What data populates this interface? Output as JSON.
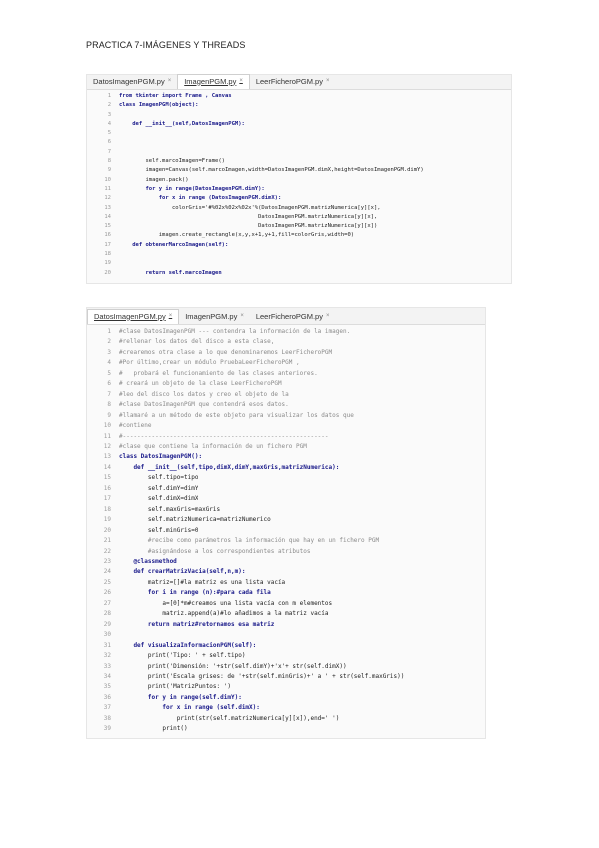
{
  "page_title": "PRACTICA 7-IMÁGENES Y THREADS",
  "editor1": {
    "tabs": [
      {
        "label": "DatosImagenPGM.py",
        "active": false
      },
      {
        "label": "ImagenPGM.py",
        "active": true
      },
      {
        "label": "LeerFicheroPGM.py",
        "active": false
      }
    ],
    "lines": [
      {
        "n": "1",
        "t": "from tkinter import Frame , Canvas"
      },
      {
        "n": "2",
        "t": "class ImagenPGM(object):"
      },
      {
        "n": "3",
        "t": ""
      },
      {
        "n": "4",
        "t": "    def __init__(self,DatosImagenPGM):"
      },
      {
        "n": "5",
        "t": ""
      },
      {
        "n": "6",
        "t": ""
      },
      {
        "n": "7",
        "t": ""
      },
      {
        "n": "8",
        "t": "        self.marcoImagen=Frame()"
      },
      {
        "n": "9",
        "t": "        imagen=Canvas(self.marcoImagen,width=DatosImagenPGM.dimX,height=DatosImagenPGM.dimY)"
      },
      {
        "n": "10",
        "t": "        imagen.pack()"
      },
      {
        "n": "11",
        "t": "        for y in range(DatosImagenPGM.dimY):"
      },
      {
        "n": "12",
        "t": "            for x in range (DatosImagenPGM.dimX):"
      },
      {
        "n": "13",
        "t": "                colorGris='#%02x%02x%02x'%(DatosImagenPGM.matrizNumerica[y][x],"
      },
      {
        "n": "14",
        "t": "                                          DatosImagenPGM.matrizNumerica[y][x],"
      },
      {
        "n": "15",
        "t": "                                          DatosImagenPGM.matrizNumerica[y][x])"
      },
      {
        "n": "16",
        "t": "            imagen.create_rectangle(x,y,x+1,y+1,fill=colorGris,width=0)"
      },
      {
        "n": "17",
        "t": "    def obtenerMarcoImagen(self):"
      },
      {
        "n": "18",
        "t": ""
      },
      {
        "n": "19",
        "t": ""
      },
      {
        "n": "20",
        "t": "        return self.marcoImagen"
      }
    ]
  },
  "editor2": {
    "tabs": [
      {
        "label": "DatosImagenPGM.py",
        "active": true
      },
      {
        "label": "ImagenPGM.py",
        "active": false
      },
      {
        "label": "LeerFicheroPGM.py",
        "active": false
      }
    ],
    "lines": [
      {
        "n": "1",
        "t": "#clase DatosImagenPGM --- contendra la información de la imagen."
      },
      {
        "n": "2",
        "t": "#rellenar los datos del disco a esta clase,"
      },
      {
        "n": "3",
        "t": "#crearemos otra clase a lo que denominaremos LeerFicheroPGM"
      },
      {
        "n": "4",
        "t": "#Por último,crear un módulo PruebaLeerFicheroPGM ,"
      },
      {
        "n": "5",
        "t": "#   probará el funcionamiento de las clases anteriores."
      },
      {
        "n": "6",
        "t": "# creará un objeto de la clase LeerFicheroPGM"
      },
      {
        "n": "7",
        "t": "#leo del disco los datos y creo el objeto de la"
      },
      {
        "n": "8",
        "t": "#clase DatosImagenPGM que contendrá esos datos."
      },
      {
        "n": "9",
        "t": "#llamaré a un método de este objeto para visualizar los datos que"
      },
      {
        "n": "10",
        "t": "#contiene"
      },
      {
        "n": "11",
        "t": "#---------------------------------------------------------"
      },
      {
        "n": "12",
        "t": "#clase que contiene la información de un fichero PGM"
      },
      {
        "n": "13",
        "t": "class DatosImagenPGM():"
      },
      {
        "n": "14",
        "t": "    def __init__(self,tipo,dimX,dimY,maxGris,matrizNumerica):"
      },
      {
        "n": "15",
        "t": "        self.tipo=tipo"
      },
      {
        "n": "16",
        "t": "        self.dimY=dimY"
      },
      {
        "n": "17",
        "t": "        self.dimX=dimX"
      },
      {
        "n": "18",
        "t": "        self.maxGris=maxGris"
      },
      {
        "n": "19",
        "t": "        self.matrizNumerica=matrizNumerico"
      },
      {
        "n": "20",
        "t": "        self.minGris=0"
      },
      {
        "n": "21",
        "t": "        #recibe como parámetros la información que hay en un fichero PGM"
      },
      {
        "n": "22",
        "t": "        #asignándose a los correspondientes atributos"
      },
      {
        "n": "23",
        "t": "    @classmethod"
      },
      {
        "n": "24",
        "t": "    def crearMatrizVacia(self,n,m):"
      },
      {
        "n": "25",
        "t": "        matriz=[]#la matriz es una lista vacía"
      },
      {
        "n": "26",
        "t": "        for i in range (n):#para cada fila"
      },
      {
        "n": "27",
        "t": "            a=[0]*m#creamos una lista vacía con m elementos"
      },
      {
        "n": "28",
        "t": "            matriz.append(a)#lo añadimos a la matriz vacía"
      },
      {
        "n": "29",
        "t": "        return matriz#retornamos esa matriz"
      },
      {
        "n": "30",
        "t": ""
      },
      {
        "n": "31",
        "t": "    def visualizaInformacionPGM(self):"
      },
      {
        "n": "32",
        "t": "        print('Tipo: ' + self.tipo)"
      },
      {
        "n": "33",
        "t": "        print('Dimensión: '+str(self.dimY)+'x'+ str(self.dimX))"
      },
      {
        "n": "34",
        "t": "        print('Escala grises: de '+str(self.minGris)+' a ' + str(self.maxGris))"
      },
      {
        "n": "35",
        "t": "        print('MatrizPuntos: ')"
      },
      {
        "n": "36",
        "t": "        for y in range(self.dimY):"
      },
      {
        "n": "37",
        "t": "            for x in range (self.dimX):"
      },
      {
        "n": "38",
        "t": "                print(str(self.matrizNumerica[y][x]),end=' ')"
      },
      {
        "n": "39",
        "t": "            print()"
      }
    ]
  }
}
